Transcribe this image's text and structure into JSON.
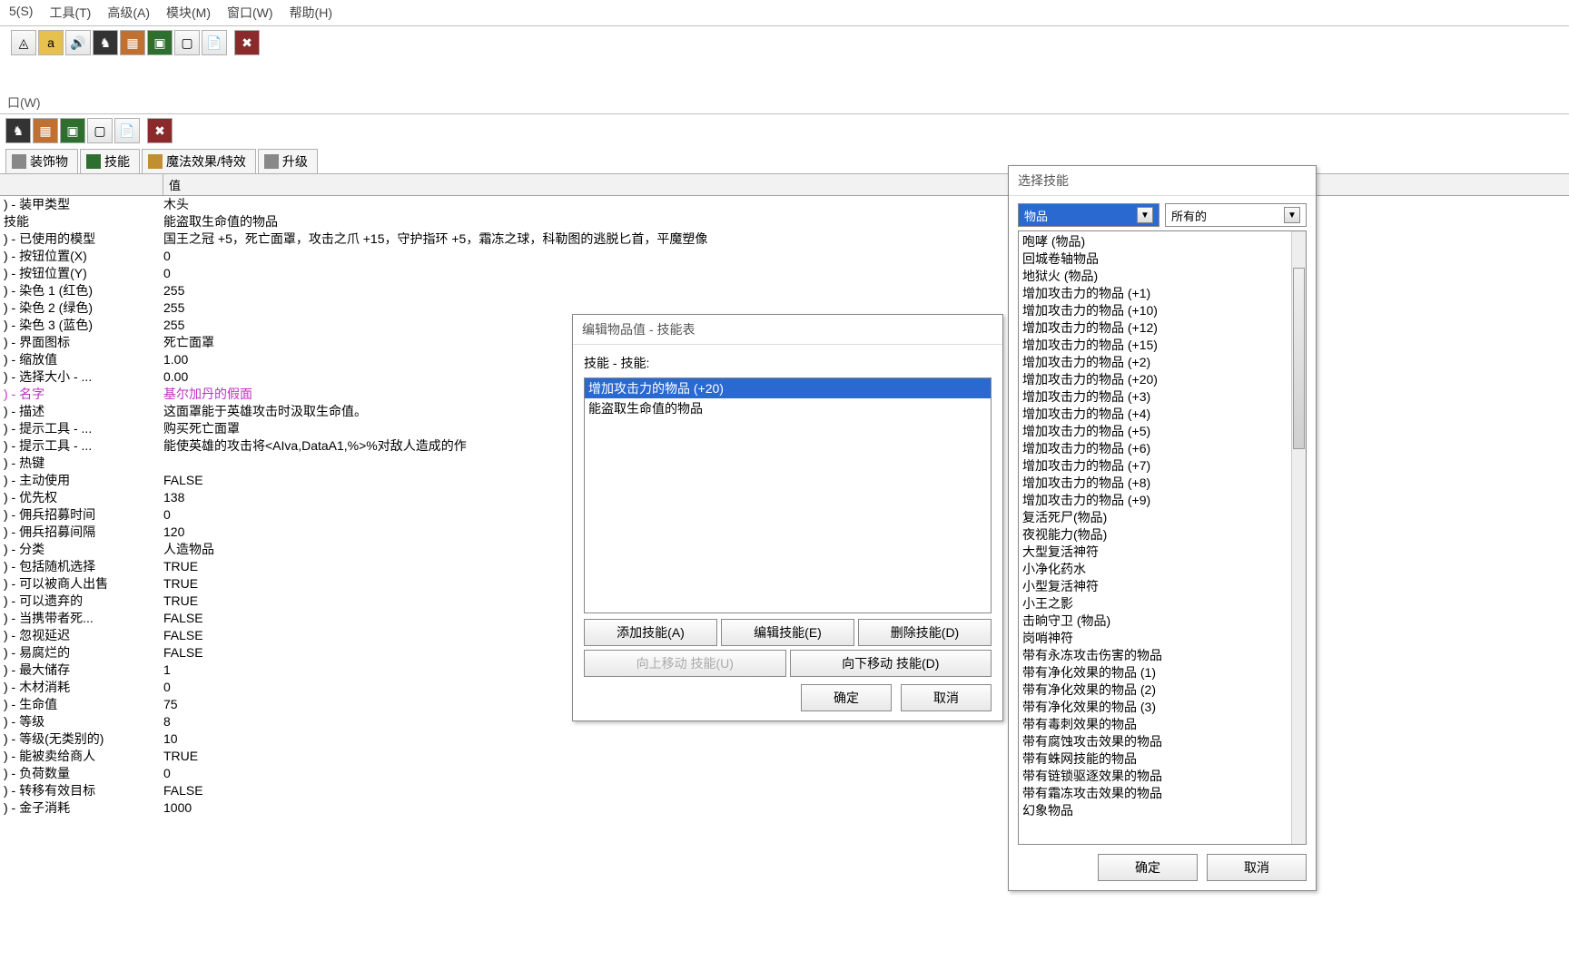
{
  "menubar": [
    "5(S)",
    "工具(T)",
    "高级(A)",
    "模块(M)",
    "窗口(W)",
    "帮助(H)"
  ],
  "subwin_title": "口(W)",
  "tabs": [
    {
      "label": "装饰物"
    },
    {
      "label": "技能"
    },
    {
      "label": "魔法效果/特效"
    },
    {
      "label": "升级"
    }
  ],
  "grid_headers": {
    "col1": "",
    "col2": "值"
  },
  "properties": [
    {
      "k": ") - 装甲类型",
      "v": "木头"
    },
    {
      "k": "技能",
      "v": "能盗取生命值的物品"
    },
    {
      "k": ") - 已使用的模型",
      "v": "国王之冠 +5，死亡面罩，攻击之爪 +15，守护指环 +5，霜冻之球，科勒图的逃脱匕首，平魔塑像"
    },
    {
      "k": ") - 按钮位置(X)",
      "v": "0"
    },
    {
      "k": ") - 按钮位置(Y)",
      "v": "0"
    },
    {
      "k": ") - 染色 1 (红色)",
      "v": "255"
    },
    {
      "k": ") - 染色 2 (绿色)",
      "v": "255"
    },
    {
      "k": ") - 染色 3 (蓝色)",
      "v": "255"
    },
    {
      "k": ") - 界面图标",
      "v": "死亡面罩"
    },
    {
      "k": ") - 缩放值",
      "v": "1.00"
    },
    {
      "k": ") - 选择大小 - ...",
      "v": "0.00"
    },
    {
      "k": ") - 名字",
      "v": "基尔加丹的假面",
      "magenta": true
    },
    {
      "k": ") - 描述",
      "v": "这面罩能于英雄攻击时汲取生命值。"
    },
    {
      "k": ") - 提示工具 - ...",
      "v": "购买死亡面罩"
    },
    {
      "k": ") - 提示工具 - ...",
      "v": "能使英雄的攻击将<AIva,DataA1,%>%对敌人造成的作"
    },
    {
      "k": ") - 热键",
      "v": ""
    },
    {
      "k": ") - 主动使用",
      "v": "FALSE"
    },
    {
      "k": ") - 优先权",
      "v": "138"
    },
    {
      "k": ") - 佣兵招募时间",
      "v": "0"
    },
    {
      "k": ") - 佣兵招募间隔",
      "v": "120"
    },
    {
      "k": ") - 分类",
      "v": "人造物品"
    },
    {
      "k": ") - 包括随机选择",
      "v": "TRUE"
    },
    {
      "k": ") - 可以被商人出售",
      "v": "TRUE"
    },
    {
      "k": ") - 可以遗弃的",
      "v": "TRUE"
    },
    {
      "k": ") - 当携带者死...",
      "v": "FALSE"
    },
    {
      "k": ") - 忽视延迟",
      "v": "FALSE"
    },
    {
      "k": ") - 易腐烂的",
      "v": "FALSE"
    },
    {
      "k": ") - 最大储存",
      "v": "1"
    },
    {
      "k": ") - 木材消耗",
      "v": "0"
    },
    {
      "k": ") - 生命值",
      "v": "75"
    },
    {
      "k": ") - 等级",
      "v": "8"
    },
    {
      "k": ") - 等级(无类别的)",
      "v": "10"
    },
    {
      "k": ") - 能被卖给商人",
      "v": "TRUE"
    },
    {
      "k": ") - 负荷数量",
      "v": "0"
    },
    {
      "k": ") - 转移有效目标",
      "v": "FALSE"
    },
    {
      "k": ") - 金子消耗",
      "v": "1000"
    }
  ],
  "edit_dialog": {
    "title": "编辑物品值 - 技能表",
    "label": "技能 - 技能:",
    "items": [
      {
        "t": "增加攻击力的物品 (+20)",
        "sel": true
      },
      {
        "t": "能盗取生命值的物品"
      }
    ],
    "buttons": {
      "add": "添加技能(A)",
      "edit": "编辑技能(E)",
      "del": "删除技能(D)",
      "up": "向上移动 技能(U)",
      "down": "向下移动 技能(D)",
      "ok": "确定",
      "cancel": "取消"
    }
  },
  "skill_dialog": {
    "title": "选择技能",
    "dropdown1": "物品",
    "dropdown2": "所有的",
    "list": [
      "咆哮 (物品)",
      "回城卷轴物品",
      "地狱火 (物品)",
      "增加攻击力的物品 (+1)",
      "增加攻击力的物品 (+10)",
      "增加攻击力的物品 (+12)",
      "增加攻击力的物品 (+15)",
      "增加攻击力的物品 (+2)",
      "增加攻击力的物品 (+20)",
      "增加攻击力的物品 (+3)",
      "增加攻击力的物品 (+4)",
      "增加攻击力的物品 (+5)",
      "增加攻击力的物品 (+6)",
      "增加攻击力的物品 (+7)",
      "增加攻击力的物品 (+8)",
      "增加攻击力的物品 (+9)",
      "复活死尸(物品)",
      "夜视能力(物品)",
      "大型复活神符",
      "小净化药水",
      "小型复活神符",
      "小王之影",
      "击晌守卫 (物品)",
      "岗哨神符",
      "带有永冻攻击伤害的物品",
      "带有净化效果的物品 (1)",
      "带有净化效果的物品 (2)",
      "带有净化效果的物品 (3)",
      "带有毒刺效果的物品",
      "带有腐蚀攻击效果的物品",
      "带有蛛网技能的物品",
      "带有链锁驱逐效果的物品",
      "带有霜冻攻击效果的物品",
      "幻象物品"
    ],
    "ok": "确定",
    "cancel": "取消"
  }
}
